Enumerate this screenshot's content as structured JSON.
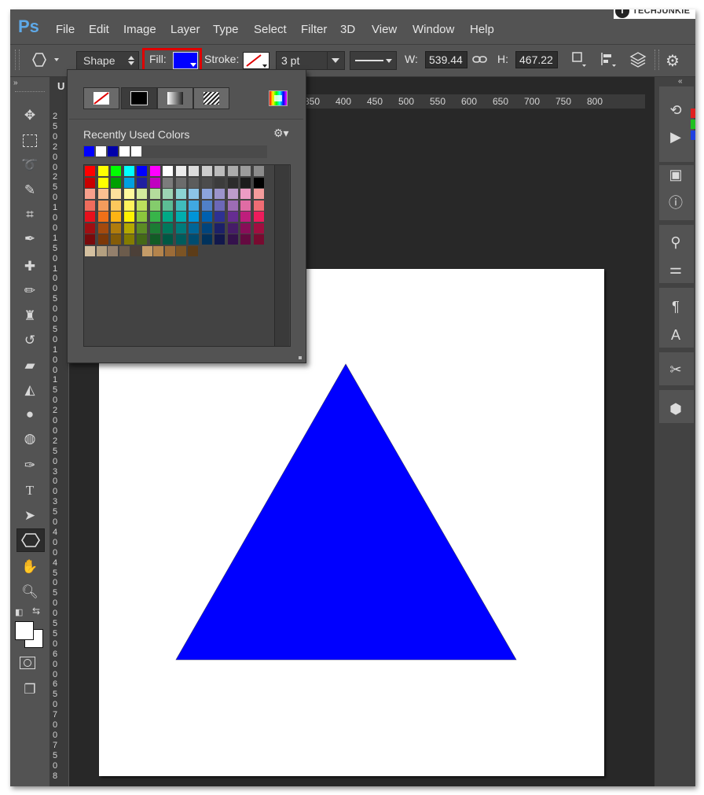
{
  "app": {
    "logo": "Ps",
    "watermark": "TECHJUNKIE",
    "watermark_mark": "T"
  },
  "menu": [
    "File",
    "Edit",
    "Image",
    "Layer",
    "Type",
    "Select",
    "Filter",
    "3D",
    "View",
    "Window",
    "Help"
  ],
  "options_bar": {
    "mode_label": "Shape",
    "fill_label": "Fill:",
    "fill_color": "#0000ff",
    "stroke_label": "Stroke:",
    "stroke_width": "3 pt",
    "w_label": "W:",
    "w_value": "539.44",
    "h_label": "H:",
    "h_value": "467.22",
    "highlight_color": "#e00000"
  },
  "fill_popup": {
    "types": [
      "no-color",
      "solid-color",
      "gradient",
      "pattern"
    ],
    "recently_used_title": "Recently Used Colors",
    "recent_colors": [
      "#0000ff",
      "#ffffff",
      "#0000aa",
      "#ffffff",
      "#ffffff"
    ],
    "swatch_rows": [
      [
        "#ff0000",
        "#ffff00",
        "#00ff00",
        "#00ffff",
        "#0000ff",
        "#ff00ff",
        "#ffffff",
        "#ececec",
        "#dcdcdc",
        "#cccccc",
        "#bcbcbc",
        "#acacac",
        "#9c9c9c",
        "#8c8c8c"
      ],
      [
        "#c80000",
        "#ffff00",
        "#00a000",
        "#00a0e0",
        "#2020a0",
        "#c000c0",
        "#7c7c7c",
        "#6c6c6c",
        "#5c5c5c",
        "#4c4c4c",
        "#3c3c3c",
        "#2c2c2c",
        "#1c1c1c",
        "#000000"
      ],
      [
        "#f7a08c",
        "#fbc090",
        "#fde09c",
        "#fff99c",
        "#d4ec9c",
        "#b4dc9c",
        "#9cd4b4",
        "#8cd4d4",
        "#8cc4e8",
        "#8ca4dc",
        "#9c94cc",
        "#bc9ccc",
        "#ec9cc4",
        "#f49c9c"
      ],
      [
        "#f06c5c",
        "#f49c5c",
        "#fcc85c",
        "#fff35c",
        "#bce05c",
        "#84cc6c",
        "#5cbc94",
        "#40bcbc",
        "#40a8e0",
        "#5080c8",
        "#6c68b8",
        "#9c6cb4",
        "#e06ca4",
        "#f06c74"
      ],
      [
        "#e8101c",
        "#f07018",
        "#fcb414",
        "#fff200",
        "#8cc63c",
        "#38b44a",
        "#00a886",
        "#00aeae",
        "#0094d8",
        "#0060b0",
        "#2e3192",
        "#662d91",
        "#be1e7c",
        "#ec1c5c"
      ],
      [
        "#a00e12",
        "#a44a0e",
        "#b07c0c",
        "#b4a800",
        "#5c8c24",
        "#1c7c34",
        "#00785c",
        "#007c7c",
        "#006698",
        "#00447c",
        "#1c2068",
        "#461c68",
        "#880e58",
        "#a00e40"
      ],
      [
        "#780a0c",
        "#7c3808",
        "#845c08",
        "#847c00",
        "#446818",
        "#125c26",
        "#005844",
        "#005c5c",
        "#004c70",
        "#00325c",
        "#12184c",
        "#34124c",
        "#640a40",
        "#780a30"
      ]
    ],
    "skin_colors": [
      "#d4c0a0",
      "#b4a080",
      "#94806c",
      "#6c5c4c",
      "#4c4038",
      "#c49c68",
      "#b4844c",
      "#9c6c38",
      "#7c5424",
      "#5c3c18"
    ]
  },
  "rulers": {
    "horizontal": [
      "350",
      "400",
      "450",
      "500",
      "550",
      "600",
      "650",
      "700",
      "750",
      "800"
    ],
    "vertical_digits": [
      "2",
      "5",
      "0",
      "2",
      "0",
      "0",
      "2",
      "5",
      "0",
      "1",
      "0",
      "0",
      "1",
      "5",
      "0",
      "1",
      "0",
      "0",
      "5",
      "0",
      "0",
      "5",
      "0",
      "1",
      "0",
      "0",
      "1",
      "5",
      "0",
      "2",
      "0",
      "0",
      "2",
      "5",
      "0",
      "3",
      "0",
      "0",
      "3",
      "5",
      "0",
      "4",
      "0",
      "0",
      "4",
      "5",
      "0",
      "5",
      "0",
      "0",
      "5",
      "5",
      "0",
      "6",
      "0",
      "0",
      "6",
      "5",
      "0",
      "7",
      "0",
      "0",
      "7",
      "5",
      "0",
      "8"
    ]
  },
  "tab_label": "U",
  "shape": {
    "type": "triangle",
    "fill": "#0000ff"
  }
}
